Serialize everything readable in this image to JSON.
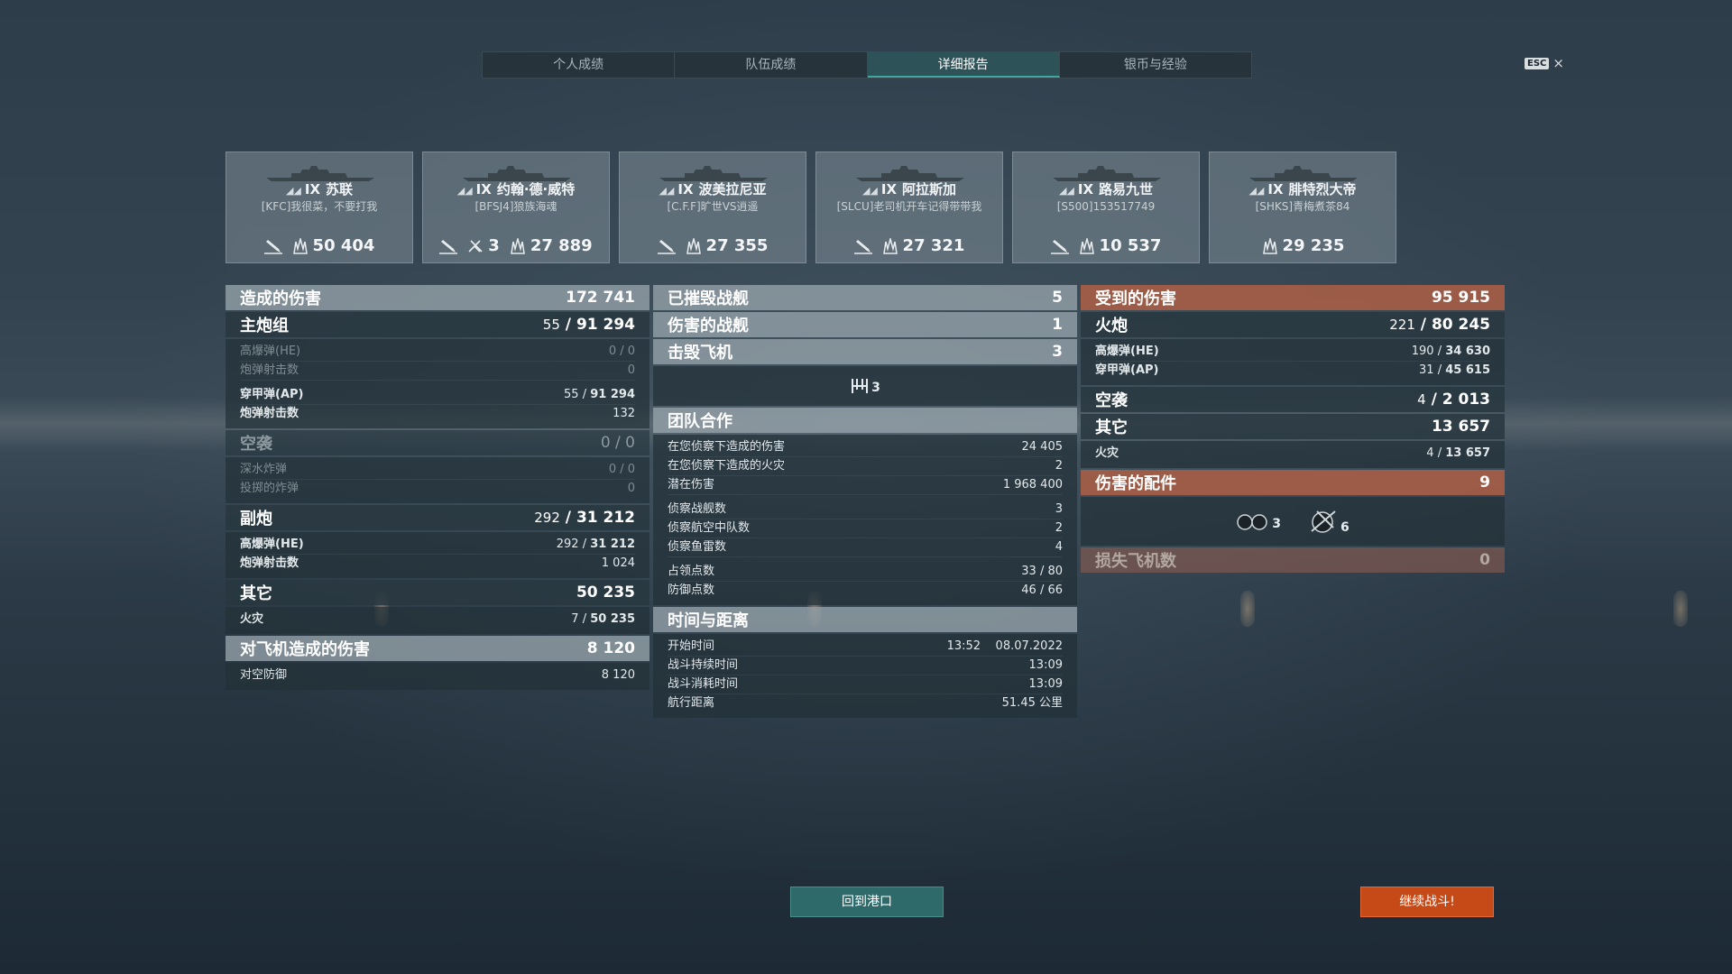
{
  "tabs": [
    "个人成绩",
    "队伍成绩",
    "详细报告",
    "银币与经验"
  ],
  "esc": {
    "key": "ESC",
    "close": "×"
  },
  "ships": [
    {
      "tier": "IX",
      "name": "苏联",
      "player": "[KFC]我很菜，不要打我",
      "kills": "",
      "damage": "50 404"
    },
    {
      "tier": "IX",
      "name": "约翰·德·威特",
      "player": "[BFSJ4]狼族海魂",
      "kills": "3",
      "damage": "27 889"
    },
    {
      "tier": "IX",
      "name": "波美拉尼亚",
      "player": "[C.F.F]旷世VS逍遥",
      "kills": "",
      "damage": "27 355"
    },
    {
      "tier": "IX",
      "name": "阿拉斯加",
      "player": "[SLCU]老司机开车记得带带我",
      "kills": "",
      "damage": "27 321"
    },
    {
      "tier": "IX",
      "name": "路易九世",
      "player": "[S500]153517749",
      "kills": "",
      "damage": "10 537"
    },
    {
      "tier": "IX",
      "name": "腓特烈大帝",
      "player": "[SHKS]青梅煮茶84",
      "kills": "",
      "damage": "29 235"
    }
  ],
  "left": {
    "dealt": {
      "label": "造成的伤害",
      "value": "172 741"
    },
    "main": {
      "label": "主炮组",
      "hits": "55",
      "dmg": "91 294",
      "he_label": "高爆弹(HE)",
      "he_value": "0 / 0",
      "he_shots_label": "炮弹射击数",
      "he_shots": "0",
      "ap_label": "穿甲弹(AP)",
      "ap_hits": "55",
      "ap_dmg": "91 294",
      "ap_shots_label": "炮弹射击数",
      "ap_shots": "132"
    },
    "air": {
      "label": "空袭",
      "value": "0 / 0",
      "dc_label": "深水炸弹",
      "dc_value": "0 / 0",
      "bomb_label": "投掷的炸弹",
      "bomb_value": "0"
    },
    "secondary": {
      "label": "副炮",
      "hits": "292",
      "dmg": "31 212",
      "he_label": "高爆弹(HE)",
      "he_hits": "292",
      "he_dmg": "31 212",
      "shots_label": "炮弹射击数",
      "shots": "1 024"
    },
    "other": {
      "label": "其它",
      "value": "50 235",
      "fire_label": "火灾",
      "fire_count": "7",
      "fire_dmg": "50 235"
    },
    "aa": {
      "label": "对飞机造成的伤害",
      "value": "8 120",
      "def_label": "对空防御",
      "def_value": "8 120"
    }
  },
  "mid": {
    "destroyed": {
      "label": "已摧毁战舰",
      "value": "5"
    },
    "damaged": {
      "label": "伤害的战舰",
      "value": "1"
    },
    "planes": {
      "label": "击毁飞机",
      "value": "3",
      "icon_count": "3"
    },
    "team": {
      "label": "团队合作",
      "rows": [
        {
          "label": "在您侦察下造成的伤害",
          "value": "24 405"
        },
        {
          "label": "在您侦察下造成的火灾",
          "value": "2"
        },
        {
          "label": "潜在伤害",
          "value": "1 968 400"
        },
        {
          "label": "侦察战舰数",
          "value": "3"
        },
        {
          "label": "侦察航空中队数",
          "value": "2"
        },
        {
          "label": "侦察鱼雷数",
          "value": "4"
        },
        {
          "label": "占领点数",
          "value": "33 / 80"
        },
        {
          "label": "防御点数",
          "value": "46 / 66"
        }
      ]
    },
    "time": {
      "label": "时间与距离",
      "rows": [
        {
          "label": "开始时间",
          "value": "13:52    08.07.2022"
        },
        {
          "label": "战斗持续时间",
          "value": "13:09"
        },
        {
          "label": "战斗消耗时间",
          "value": "13:09"
        },
        {
          "label": "航行距离",
          "value": "51.45 公里"
        }
      ]
    }
  },
  "right": {
    "received": {
      "label": "受到的伤害",
      "value": "95 915"
    },
    "guns": {
      "label": "火炮",
      "hits": "221",
      "dmg": "80 245",
      "he_label": "高爆弹(HE)",
      "he_hits": "190",
      "he_dmg": "34 630",
      "ap_label": "穿甲弹(AP)",
      "ap_hits": "31",
      "ap_dmg": "45 615"
    },
    "air": {
      "label": "空袭",
      "hits": "4",
      "dmg": "2 013"
    },
    "other": {
      "label": "其它",
      "value": "13 657",
      "fire_label": "火灾",
      "fire_count": "4",
      "fire_dmg": "13 657"
    },
    "parts": {
      "label": "伤害的配件",
      "value": "9",
      "modules": "3",
      "guns": "6"
    },
    "lost": {
      "label": "损失飞机数",
      "value": "0"
    }
  },
  "buttons": {
    "port": "回到港口",
    "battle": "继续战斗!"
  }
}
